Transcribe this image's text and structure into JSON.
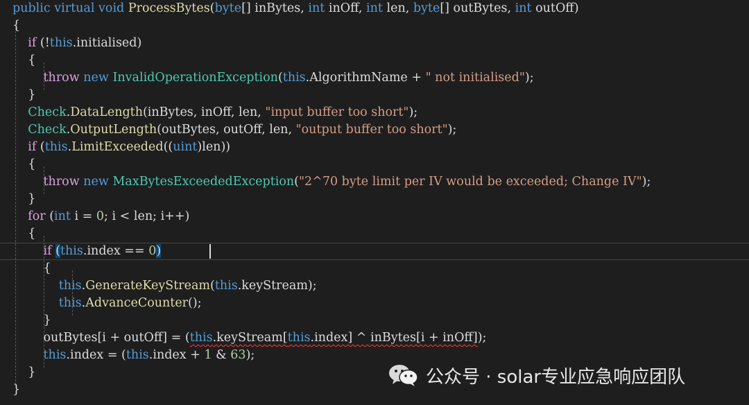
{
  "editor": {
    "lines": [
      [
        [
          "kw",
          "public"
        ],
        [
          "pl",
          " "
        ],
        [
          "kw",
          "virtual"
        ],
        [
          "pl",
          " "
        ],
        [
          "kw",
          "void"
        ],
        [
          "pl",
          " "
        ],
        [
          "fn",
          "ProcessBytes"
        ],
        [
          "pl",
          "("
        ],
        [
          "kw",
          "byte"
        ],
        [
          "pl",
          "[] inBytes, "
        ],
        [
          "kw",
          "int"
        ],
        [
          "pl",
          " inOff, "
        ],
        [
          "kw",
          "int"
        ],
        [
          "pl",
          " len, "
        ],
        [
          "kw",
          "byte"
        ],
        [
          "pl",
          "[] outBytes, "
        ],
        [
          "kw",
          "int"
        ],
        [
          "pl",
          " outOff)"
        ]
      ],
      [
        [
          "pl",
          "{"
        ]
      ],
      [
        [
          "pl",
          "    "
        ],
        [
          "ctl",
          "if"
        ],
        [
          "pl",
          " (!"
        ],
        [
          "kw",
          "this"
        ],
        [
          "pl",
          ".initialised)"
        ]
      ],
      [
        [
          "pl",
          "    {"
        ]
      ],
      [
        [
          "pl",
          "        "
        ],
        [
          "ctl",
          "throw"
        ],
        [
          "pl",
          " "
        ],
        [
          "kw",
          "new"
        ],
        [
          "pl",
          " "
        ],
        [
          "cls",
          "InvalidOperationException"
        ],
        [
          "pl",
          "("
        ],
        [
          "kw",
          "this"
        ],
        [
          "pl",
          ".AlgorithmName + "
        ],
        [
          "str",
          "\" not initialised\""
        ],
        [
          "pl",
          ");"
        ]
      ],
      [
        [
          "pl",
          "    }"
        ]
      ],
      [
        [
          "pl",
          "    "
        ],
        [
          "cls",
          "Check"
        ],
        [
          "pl",
          "."
        ],
        [
          "fn",
          "DataLength"
        ],
        [
          "pl",
          "(inBytes, inOff, len, "
        ],
        [
          "str",
          "\"input buffer too short\""
        ],
        [
          "pl",
          ");"
        ]
      ],
      [
        [
          "pl",
          "    "
        ],
        [
          "cls",
          "Check"
        ],
        [
          "pl",
          "."
        ],
        [
          "fn",
          "OutputLength"
        ],
        [
          "pl",
          "(outBytes, outOff, len, "
        ],
        [
          "str",
          "\"output buffer too short\""
        ],
        [
          "pl",
          ");"
        ]
      ],
      [
        [
          "pl",
          "    "
        ],
        [
          "ctl",
          "if"
        ],
        [
          "pl",
          " ("
        ],
        [
          "kw",
          "this"
        ],
        [
          "pl",
          "."
        ],
        [
          "fn",
          "LimitExceeded"
        ],
        [
          "pl",
          "(("
        ],
        [
          "kw",
          "uint"
        ],
        [
          "pl",
          ")len))"
        ]
      ],
      [
        [
          "pl",
          "    {"
        ]
      ],
      [
        [
          "pl",
          "        "
        ],
        [
          "ctl",
          "throw"
        ],
        [
          "pl",
          " "
        ],
        [
          "kw",
          "new"
        ],
        [
          "pl",
          " "
        ],
        [
          "cls",
          "MaxBytesExceededException"
        ],
        [
          "pl",
          "("
        ],
        [
          "str",
          "\"2^70 byte limit per IV would be exceeded; Change IV\""
        ],
        [
          "pl",
          ");"
        ]
      ],
      [
        [
          "pl",
          "    }"
        ]
      ],
      [
        [
          "pl",
          "    "
        ],
        [
          "ctl",
          "for"
        ],
        [
          "pl",
          " ("
        ],
        [
          "kw",
          "int"
        ],
        [
          "pl",
          " i = "
        ],
        [
          "num",
          "0"
        ],
        [
          "pl",
          "; i < len; i++)"
        ]
      ],
      [
        [
          "pl",
          "    {"
        ]
      ],
      [
        [
          "pl",
          "        "
        ],
        [
          "ctl",
          "if"
        ],
        [
          "pl",
          " "
        ],
        [
          "bracehl",
          "("
        ],
        [
          "kw",
          "this"
        ],
        [
          "pl",
          ".index == "
        ],
        [
          "num",
          "0"
        ],
        [
          "bracehl",
          ")"
        ]
      ],
      [
        [
          "pl",
          "        {"
        ]
      ],
      [
        [
          "pl",
          "            "
        ],
        [
          "kw",
          "this"
        ],
        [
          "pl",
          "."
        ],
        [
          "fn",
          "GenerateKeyStream"
        ],
        [
          "pl",
          "("
        ],
        [
          "kw",
          "this"
        ],
        [
          "pl",
          ".keyStream);"
        ]
      ],
      [
        [
          "pl",
          "            "
        ],
        [
          "kw",
          "this"
        ],
        [
          "pl",
          "."
        ],
        [
          "fn",
          "AdvanceCounter"
        ],
        [
          "pl",
          "();"
        ]
      ],
      [
        [
          "pl",
          "        }"
        ]
      ],
      [
        [
          "pl",
          "        outBytes[i + outOff] = ("
        ],
        [
          "sq",
          [
            [
              "kw",
              "this"
            ],
            [
              "pl",
              ".keyStream["
            ],
            [
              "kw",
              "this"
            ],
            [
              "pl",
              ".index] ^ inBytes[i + inOff]"
            ]
          ]
        ],
        [
          "pl",
          ");"
        ]
      ],
      [
        [
          "pl",
          "        "
        ],
        [
          "kw",
          "this"
        ],
        [
          "pl",
          ".index = ("
        ],
        [
          "kw",
          "this"
        ],
        [
          "pl",
          ".index + "
        ],
        [
          "num",
          "1"
        ],
        [
          "pl",
          " & "
        ],
        [
          "num",
          "63"
        ],
        [
          "pl",
          ");"
        ]
      ],
      [
        [
          "pl",
          "    }"
        ]
      ],
      [
        [
          "pl",
          "}"
        ]
      ]
    ]
  },
  "watermark": {
    "text": "公众号 · solar专业应急响应团队",
    "icon": "wechat-icon"
  }
}
